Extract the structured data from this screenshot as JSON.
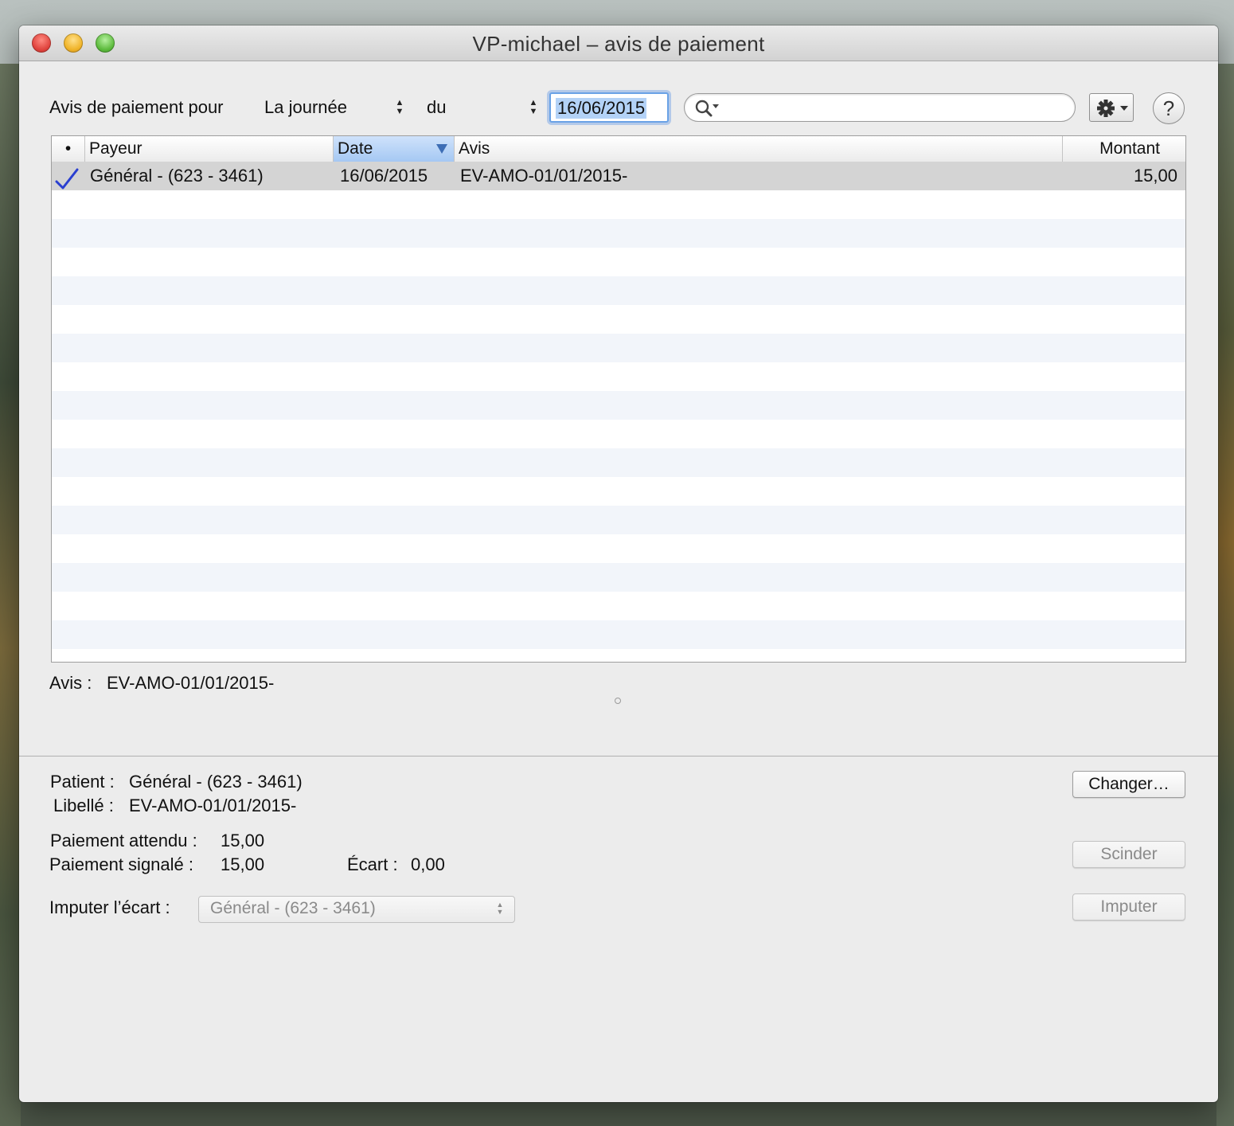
{
  "window": {
    "title": "VP-michael – avis de paiement"
  },
  "toolbar": {
    "label": "Avis de paiement pour",
    "period_value": "La journée",
    "du_label": "du",
    "date_value": "16/06/2015",
    "search_placeholder": "",
    "gear_icon": "gear-icon",
    "help_label": "?"
  },
  "table": {
    "columns": [
      "•",
      "Payeur",
      "Date",
      "Avis",
      "Montant"
    ],
    "sorted_column": "Date",
    "rows": [
      {
        "status": "checkmark-icon",
        "payeur": "Général - (623 - 3461)",
        "date": "16/06/2015",
        "avis": "EV-AMO-01/01/2015-",
        "montant": "15,00"
      }
    ]
  },
  "detail": {
    "avis_label": "Avis :",
    "avis_value": "EV-AMO-01/01/2015-"
  },
  "payment": {
    "patient_label": "Patient :",
    "patient_value": "Général - (623 - 3461)",
    "libelle_label": "Libellé :",
    "libelle_value": "EV-AMO-01/01/2015-",
    "attendu_label": "Paiement attendu :",
    "attendu_value": "15,00",
    "signale_label": "Paiement signalé :",
    "signale_value": "15,00",
    "ecart_label": "Écart :",
    "ecart_value": "0,00",
    "imputer_label": "Imputer l’écart :",
    "imputer_value": "Général - (623 - 3461)"
  },
  "buttons": {
    "changer": "Changer…",
    "scinder": "Scinder",
    "imputer": "Imputer"
  },
  "colors": {
    "selection_blue": "#6aa2e6",
    "checkmark": "#2a3fd0"
  }
}
